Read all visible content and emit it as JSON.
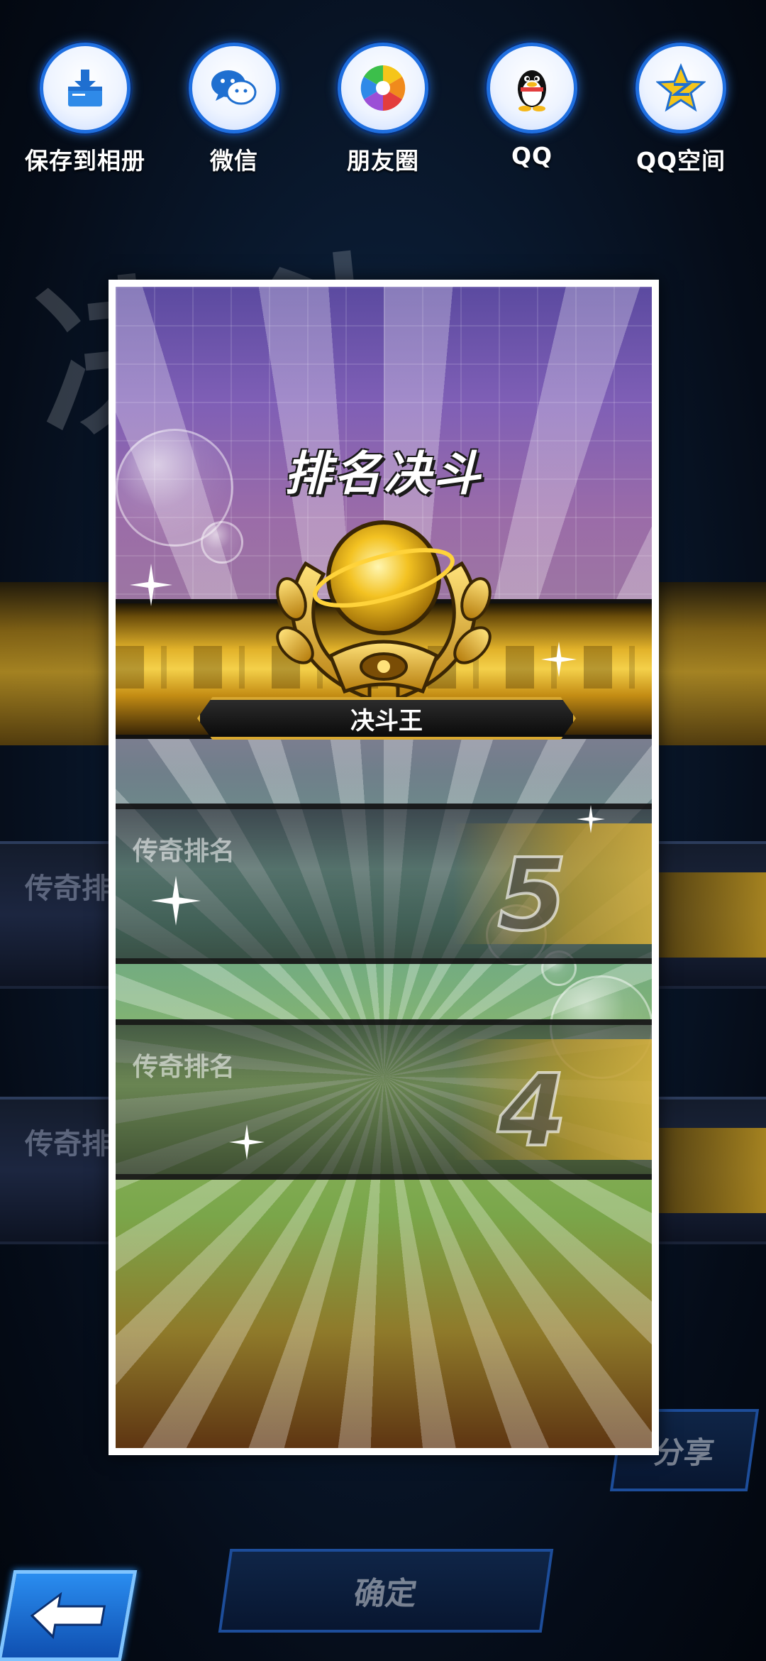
{
  "share_bar": {
    "items": [
      {
        "label": "保存到相册",
        "icon": "download-to-album-icon"
      },
      {
        "label": "微信",
        "icon": "wechat-icon"
      },
      {
        "label": "朋友圈",
        "icon": "moments-aperture-icon"
      },
      {
        "label": "QQ",
        "icon": "qq-penguin-icon"
      },
      {
        "label": "QQ空间",
        "icon": "qzone-star-icon"
      }
    ]
  },
  "card": {
    "title": "排名决斗",
    "rank_title": "决斗王",
    "rows": [
      {
        "label": "传奇排名",
        "number": "5"
      },
      {
        "label": "传奇排名",
        "number": "4"
      }
    ]
  },
  "background": {
    "rank_labels": [
      "传奇排",
      "传奇排"
    ],
    "share_label": "分享"
  },
  "controls": {
    "confirm_label": "确定",
    "back_icon": "back-arrow-icon"
  },
  "colors": {
    "accent_blue": "#1f6fe0",
    "gold": "#e2b22a",
    "card_border": "#ffffff"
  }
}
